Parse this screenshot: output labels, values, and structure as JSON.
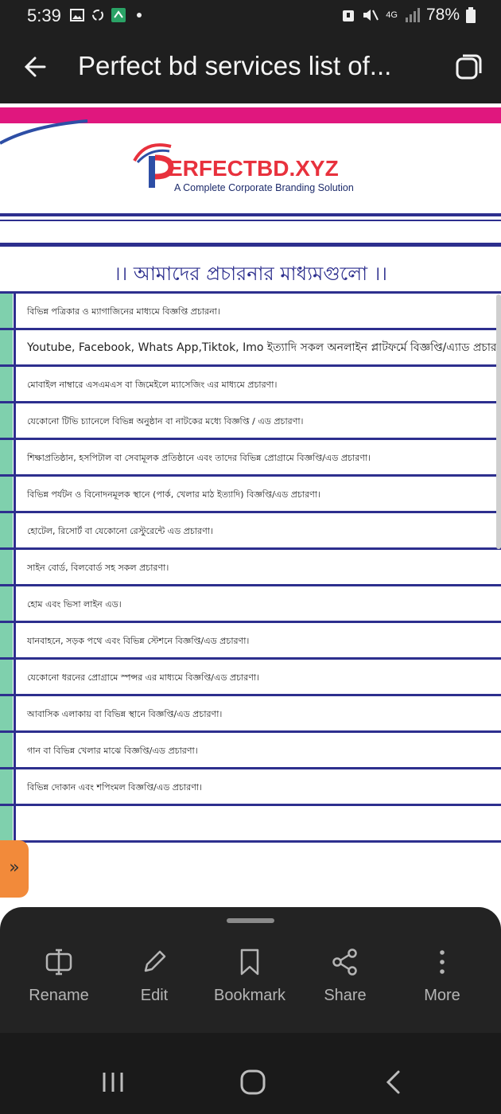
{
  "status": {
    "time": "5:39",
    "network": "4G",
    "battery": "78%"
  },
  "app_bar": {
    "title": "Perfect bd services list of..."
  },
  "document": {
    "logo_text": "ERFECTBD.XYZ",
    "logo_tagline": "A Complete Corporate Branding Solution",
    "heading": "।। আমাদের প্রচারনার মাধ্যমগুলো ।।",
    "rows": [
      "বিভিন্ন পত্রিকার ও ম্যাগাজিনের মাধ্যমে বিজ্ঞপ্তি প্রচারনা।",
      "Youtube, Facebook, Whats App,Tiktok, Imo ইত্যাদি সকল অনলাইন প্লাটফর্মে বিজ্ঞপ্তি/এ্যাড প্রচারণা।",
      "মোবাইল নাম্বারে এসএমএস বা জিমেইলে ম্যাসেজিং এর মাধ্যমে প্রচারণা।",
      "যেকোনো টিভি চ্যানেলে বিভিন্ন অনুষ্ঠান বা নাটকের মধ্যে বিজ্ঞপ্তি / এড প্রচারণা।",
      "শিক্ষাপ্রতিষ্ঠান, হসপিটাল বা সেবামূলক প্রতিষ্ঠানে এবং তাদের বিভিন্ন প্রোগ্রামে বিজ্ঞপ্তি/এড প্রচারণা।",
      "বিভিন্ন পর্যটন ও বিনোদনমূলক স্থানে (পার্ক, খেলার মাঠ ইত্যাদি) বিজ্ঞপ্তি/এড প্রচারণা।",
      "হোটেল, রিসোর্ট বা যেকোনো রেস্টুরেন্টে এড প্রচারণা।",
      "সাইন বোর্ড, বিলবোর্ড সহ সকল প্রচারণা।",
      "হোম এবং ভিসা লাইন এড।",
      "যানবাহনে, সড়ক পথে এবং বিভিন্ন স্টেশনে বিজ্ঞপ্তি/এড প্রচারণা।",
      "যেকোনো ধরনের প্রোগ্রামে স্পন্সর এর মাধ্যমে বিজ্ঞপ্তি/এড প্রচারণা।",
      "আবাসিক এলাকায় বা বিভিন্ন স্থানে বিজ্ঞপ্তি/এড প্রচারণা।",
      "গান বা বিভিন্ন খেলার মাঝে বিজ্ঞপ্তি/এড প্রচারণা।",
      "বিভিন্ন দোকান এবং শপিংমল বিজ্ঞপ্তি/এড প্রচারণা।",
      "",
      ""
    ]
  },
  "side_tab": {
    "label": "»"
  },
  "actions": {
    "rename": "Rename",
    "edit": "Edit",
    "bookmark": "Bookmark",
    "share": "Share",
    "more": "More"
  },
  "colors": {
    "accent_blue": "#2d2f8e",
    "pink_band": "#e0177e",
    "green_bar": "#7fd0ad",
    "side_tab": "#f28a3a"
  }
}
